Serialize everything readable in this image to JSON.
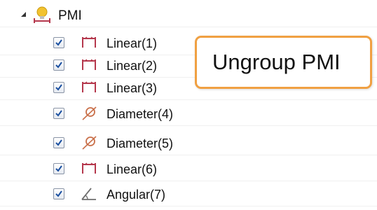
{
  "tree": {
    "root": {
      "label": "PMI",
      "expanded": true,
      "icon": "pmi-lightbulb-icon"
    },
    "items": [
      {
        "label": "Linear(1)",
        "checked": true,
        "icon": "linear-dimension-icon"
      },
      {
        "label": "Linear(2)",
        "checked": true,
        "icon": "linear-dimension-icon"
      },
      {
        "label": "Linear(3)",
        "checked": true,
        "icon": "linear-dimension-icon"
      },
      {
        "label": "Diameter(4)",
        "checked": true,
        "icon": "diameter-dimension-icon"
      },
      {
        "label": "Diameter(5)",
        "checked": true,
        "icon": "diameter-dimension-icon"
      },
      {
        "label": "Linear(6)",
        "checked": true,
        "icon": "linear-dimension-icon"
      },
      {
        "label": "Angular(7)",
        "checked": true,
        "icon": "angular-dimension-icon"
      }
    ]
  },
  "tooltip": {
    "text": "Ungroup PMI"
  },
  "colors": {
    "linear": "#b5384d",
    "diameter": "#c9704a",
    "angular": "#6e6e6e",
    "tooltip_border": "#f0a042",
    "bulb": "#f2c230"
  }
}
